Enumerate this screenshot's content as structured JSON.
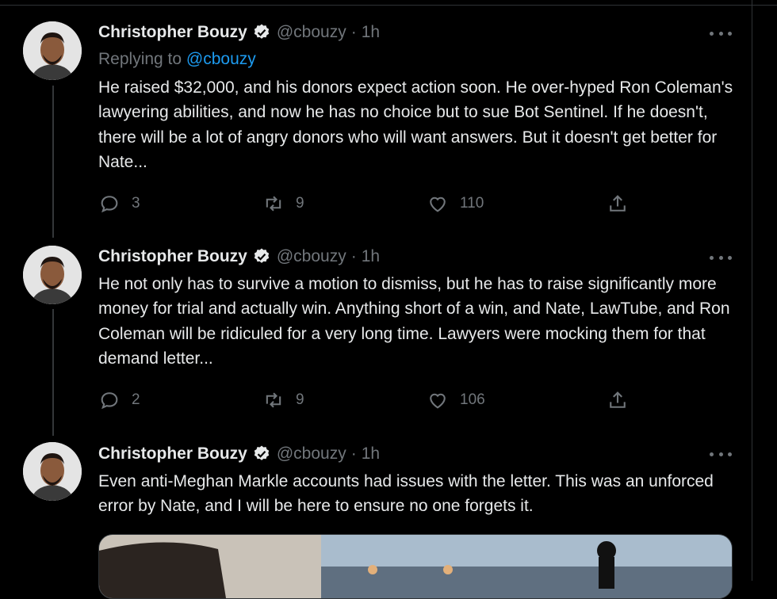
{
  "tweets": [
    {
      "author": {
        "name": "Christopher Bouzy",
        "handle": "@cbouzy"
      },
      "separator": "·",
      "time": "1h",
      "replying": {
        "prefix": "Replying to",
        "mention": "@cbouzy"
      },
      "text": "He raised $32,000, and his donors expect action soon. He over-hyped Ron Coleman's lawyering abilities, and now he has no choice but to sue Bot Sentinel. If he doesn't, there will be a lot of angry donors who will want answers. But it doesn't get better for Nate...",
      "replies": "3",
      "retweets": "9",
      "likes": "110"
    },
    {
      "author": {
        "name": "Christopher Bouzy",
        "handle": "@cbouzy"
      },
      "separator": "·",
      "time": "1h",
      "text": "He not only has to survive a motion to dismiss, but he has to raise significantly more money for trial and actually win. Anything short of a win, and Nate, LawTube, and Ron Coleman will be ridiculed for a very long time. Lawyers were mocking them for that demand letter...",
      "replies": "2",
      "retweets": "9",
      "likes": "106"
    },
    {
      "author": {
        "name": "Christopher Bouzy",
        "handle": "@cbouzy"
      },
      "separator": "·",
      "time": "1h",
      "text": "Even anti-Meghan Markle accounts had issues with the letter. This was an unforced error by Nate, and I will be here to ensure no one forgets it."
    }
  ],
  "icons": {
    "reply": "speech-bubble-icon",
    "retweet": "retweet-icon",
    "like": "heart-icon",
    "share": "share-icon",
    "verified": "verified-badge-icon",
    "more": "more-dots-icon"
  },
  "colors": {
    "background": "#000000",
    "text": "#e7e9ea",
    "muted": "#71767b",
    "link": "#1d9bf0"
  }
}
